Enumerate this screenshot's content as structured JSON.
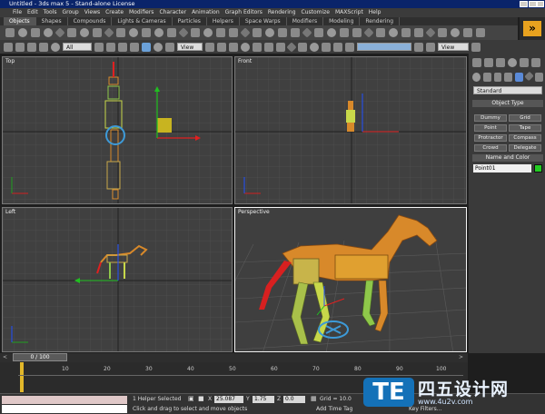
{
  "window": {
    "title": "Untitled - 3ds max 5 - Stand-alone License"
  },
  "menu": [
    "File",
    "Edit",
    "Tools",
    "Group",
    "Views",
    "Create",
    "Modifiers",
    "Character",
    "Animation",
    "Graph Editors",
    "Rendering",
    "Customize",
    "MAXScript",
    "Help"
  ],
  "tabs": [
    "Objects",
    "Shapes",
    "Compounds",
    "Lights & Cameras",
    "Particles",
    "Helpers",
    "Space Warps",
    "Modifiers",
    "Modeling",
    "Rendering"
  ],
  "toolbar": {
    "selection_filter": "All",
    "ref_coord": "View",
    "named_sel_placeholder": "",
    "view_dropdown": "View"
  },
  "viewports": {
    "top": "Top",
    "front": "Front",
    "left": "Left",
    "perspective": "Perspective"
  },
  "command_panel": {
    "category": "Standard",
    "object_type_title": "Object Type",
    "buttons": [
      "Dummy",
      "Grid",
      "Point",
      "Tape",
      "Protractor",
      "Compass",
      "Crowd",
      "Delegate"
    ],
    "name_color_title": "Name and Color",
    "object_name": "Point01",
    "swatch_color": "#22cc22"
  },
  "timeline": {
    "slider_label": "0 / 100",
    "ticks": [
      "10",
      "20",
      "30",
      "40",
      "50",
      "60",
      "70",
      "80",
      "90",
      "100"
    ],
    "current_frame_fraction": 0
  },
  "status": {
    "selection": "1 Helper Selected",
    "prompt": "Click and drag to select and move objects",
    "x_label": "X",
    "x_value": "25.087",
    "y_label": "Y",
    "y_value": "1.75",
    "z_label": "Z",
    "z_value": "0.0",
    "grid": "Grid = 10.0",
    "add_time_tag": "Add Time Tag",
    "key_filters": "Key Filters..."
  },
  "watermark": {
    "badge": "TE",
    "text": "四五设计网",
    "url": "www.4u2v.com"
  },
  "colors": {
    "accent": "#e8a21f",
    "selection_white": "#f5f5f5",
    "horse": "#d8892a",
    "gizmo_x": "#e02020",
    "gizmo_y": "#20c020",
    "gizmo_z": "#2050ff"
  }
}
